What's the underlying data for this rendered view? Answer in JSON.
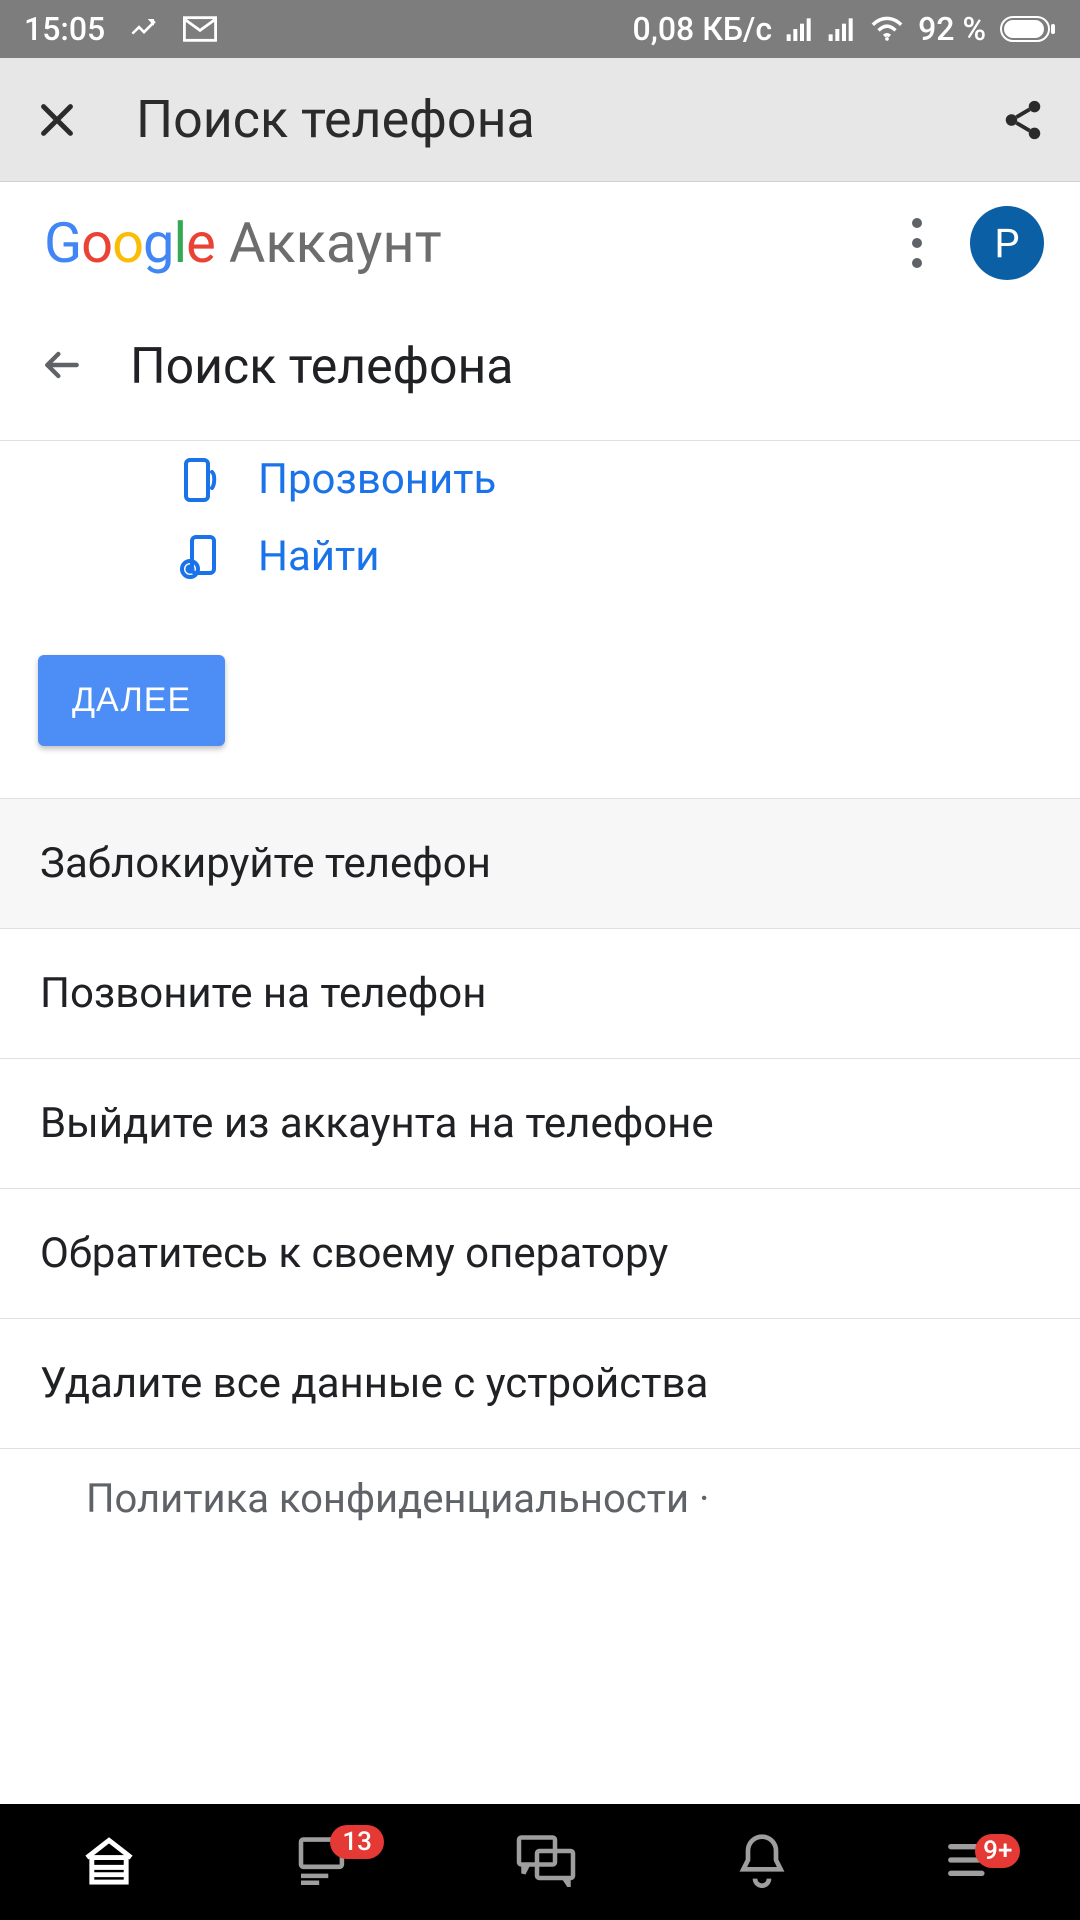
{
  "status": {
    "time": "15:05",
    "data_rate": "0,08 КБ/с",
    "battery": "92 %"
  },
  "appbar": {
    "title": "Поиск телефона"
  },
  "header": {
    "logo": "Google",
    "account_label": "Аккаунт",
    "avatar_initial": "P"
  },
  "subheader": {
    "title": "Поиск телефона"
  },
  "actions": {
    "ring": "Прозвонить",
    "locate": "Найти"
  },
  "next_button": "ДАЛЕЕ",
  "options": [
    "Заблокируйте телефон",
    "Позвоните на телефон",
    "Выйдите из аккаунта на телефоне",
    "Обратитесь к своему оператору",
    "Удалите все данные с устройства"
  ],
  "footer": {
    "policy": "Политика конфиденциальности  ·"
  },
  "bottom_nav": {
    "badge_messages": "13",
    "badge_more": "9+"
  }
}
